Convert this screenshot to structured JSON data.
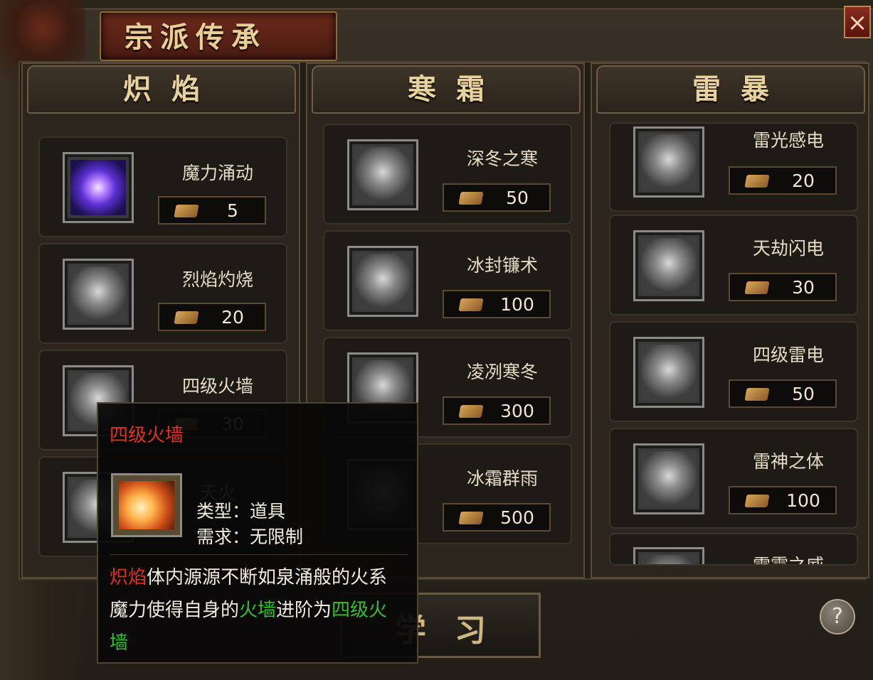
{
  "window": {
    "title": "宗派传承",
    "close_label": "×"
  },
  "columns": [
    {
      "header": "炽焰",
      "skills": [
        {
          "name": "魔力涌动",
          "cost": "5"
        },
        {
          "name": "烈焰灼烧",
          "cost": "20"
        },
        {
          "name": "四级火墙",
          "cost": "30"
        },
        {
          "name": "天火",
          "cost": ""
        }
      ]
    },
    {
      "header": "寒霜",
      "skills": [
        {
          "name": "深冬之寒",
          "cost": "50"
        },
        {
          "name": "冰封镰术",
          "cost": "100"
        },
        {
          "name": "凌冽寒冬",
          "cost": "300"
        },
        {
          "name": "冰霜群雨",
          "cost": "500"
        }
      ]
    },
    {
      "header": "雷暴",
      "skills": [
        {
          "name": "雷光感电",
          "cost": "20"
        },
        {
          "name": "天劫闪电",
          "cost": "30"
        },
        {
          "name": "四级雷电",
          "cost": "50"
        },
        {
          "name": "雷神之体",
          "cost": "100"
        },
        {
          "name": "雷霆之威",
          "cost": ""
        }
      ]
    }
  ],
  "buttons": {
    "learn": "学习",
    "help": "?"
  },
  "tooltip": {
    "title": "四级火墙",
    "type_line": "类型：道具",
    "req_line": "需求：无限制",
    "desc_1": "炽焰",
    "desc_2": "体内源源不断如泉涌般的火系魔力使得自身的",
    "desc_3": "火墙",
    "desc_4": "进阶为",
    "desc_5": "四级火墙"
  },
  "colors": {
    "accent_gold": "#e8d39e",
    "tooltip_red": "#e0321e",
    "tooltip_green": "#2ec42a"
  },
  "icons": [
    "scroll-icon",
    "purple-orb-icon",
    "fire-icon",
    "lightning-icon",
    "ice-icon"
  ]
}
